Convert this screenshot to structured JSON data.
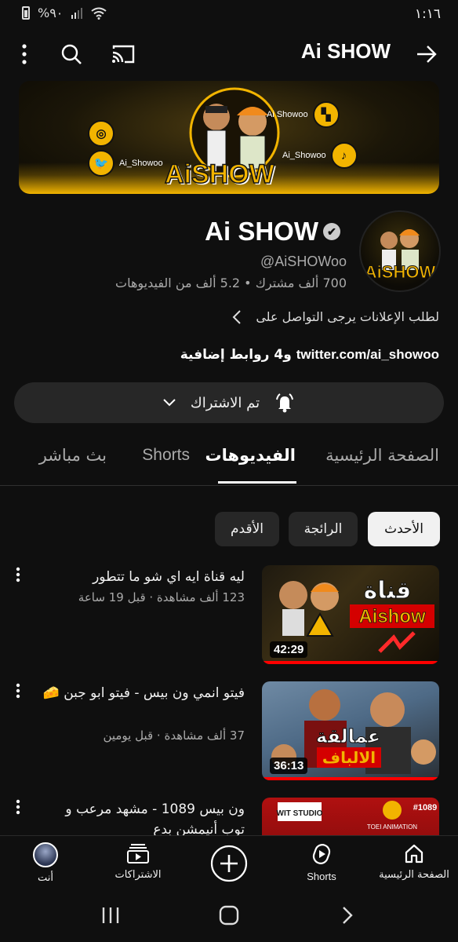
{
  "status_bar": {
    "time": "١:١٦",
    "battery_text": "%٩٠"
  },
  "header": {
    "title": "Ai SHOW"
  },
  "banner": {
    "handle_left": "Ai_Showoo",
    "handle_right_top": "Ai Showoo",
    "handle_right_bottom": "Ai_Showoo",
    "logo": "AiSHOW",
    "brand_color": "#f2b400"
  },
  "channel": {
    "name": "Ai SHOW",
    "handle": "@AiSHOWoo",
    "stats": "700 ألف مشترك • 5.2 ألف من الفيديوهات",
    "description": "لطلب الإعلانات يرجى التواصل على",
    "links_primary": "twitter.com/ai_showoo",
    "links_suffix": " و4 روابط إضافية"
  },
  "subscribe": {
    "label": "تم الاشتراك"
  },
  "tabs": [
    {
      "label": "الصفحة الرئيسية"
    },
    {
      "label": "الفيديوهات",
      "active": true
    },
    {
      "label": "Shorts"
    },
    {
      "label": "بث مباشر"
    }
  ],
  "chips": [
    {
      "label": "الأحدث",
      "selected": true
    },
    {
      "label": "الرائجة"
    },
    {
      "label": "الأقدم"
    }
  ],
  "videos": [
    {
      "title": "ليه قناة ايه اي شو ما تتطور",
      "meta": "123 ألف مشاهدة · قبل 19 ساعة",
      "duration": "42:29",
      "thumb_text": "قناة",
      "thumb_sub": "Aishow",
      "watched": 1.0
    },
    {
      "title": "فيتو انمي ون بيس - فيتو ابو جبن 🧀",
      "meta": "37 ألف مشاهدة · قبل يومين",
      "duration": "36:13",
      "thumb_text": "عمالقة",
      "thumb_sub": "الالباف",
      "watched": 1.0
    },
    {
      "title": "ون بيس 1089 - مشهد مرعب و",
      "title_line2": "توب أنيمشن بدع",
      "thumb_text": "#1089",
      "thumb_brand_a": "WIT STUDIO",
      "thumb_brand_b": "TOEI ANIMATION"
    }
  ],
  "bottom_nav": [
    {
      "label": "الصفحة الرئيسية",
      "icon": "home-icon"
    },
    {
      "label": "Shorts",
      "icon": "shorts-icon"
    },
    {
      "label": "",
      "icon": "create-icon"
    },
    {
      "label": "الاشتراكات",
      "icon": "subscriptions-icon"
    },
    {
      "label": "أنت",
      "icon": "avatar"
    }
  ],
  "colors": {
    "background": "#0f0f0f",
    "chip": "#272727",
    "accent_red": "#ff0000"
  }
}
